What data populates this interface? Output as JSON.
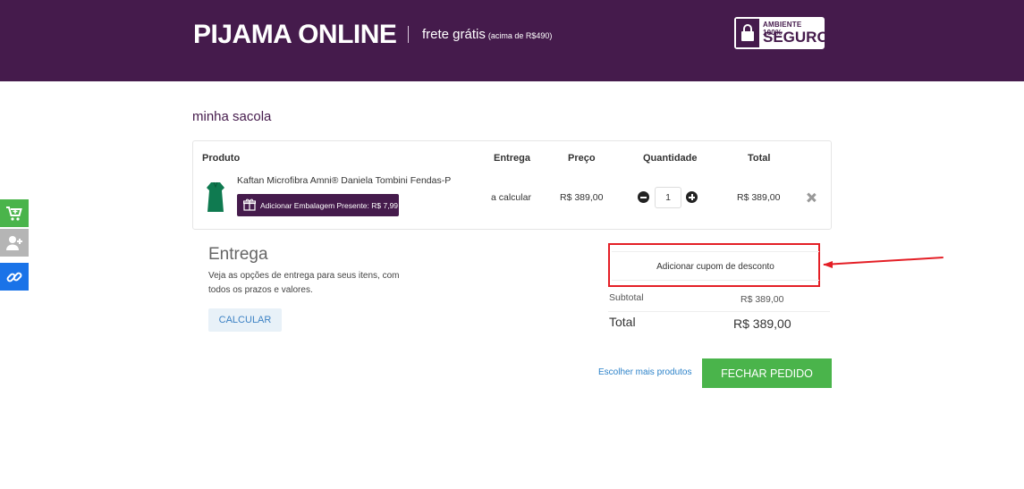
{
  "header": {
    "brand": "PIJAMA ONLINE",
    "shipping_text": "frete grátis",
    "shipping_note": "(acima de R$490)",
    "badge_line1": "AMBIENTE 100%",
    "badge_line2": "SEGURO"
  },
  "page": {
    "title": "minha sacola"
  },
  "cart": {
    "columns": {
      "product": "Produto",
      "delivery": "Entrega",
      "price": "Preço",
      "quantity": "Quantidade",
      "total": "Total"
    },
    "items": [
      {
        "name": "Kaftan Microfibra Amni® Daniela Tombini Fendas-P",
        "gift_label": "Adicionar Embalagem Presente: R$ 7,99",
        "delivery": "a calcular",
        "price": "R$ 389,00",
        "quantity": "1",
        "total": "R$ 389,00"
      }
    ]
  },
  "shipping": {
    "title": "Entrega",
    "description": "Veja as opções de entrega para seus itens, com todos os prazos e valores.",
    "calc_label": "CALCULAR"
  },
  "summary": {
    "coupon_label": "Adicionar cupom de desconto",
    "subtotal_label": "Subtotal",
    "subtotal_value": "R$ 389,00",
    "total_label": "Total",
    "total_value": "R$ 389,00"
  },
  "actions": {
    "more_products": "Escolher mais produtos",
    "checkout": "FECHAR PEDIDO"
  },
  "sidebar": [
    {
      "icon": "cart-add-icon",
      "color": "#4ab44b"
    },
    {
      "icon": "user-add-icon",
      "color": "#b5b5b5"
    },
    {
      "icon": "link-icon",
      "color": "#1a73e8"
    }
  ],
  "colors": {
    "brand": "#451b4c",
    "accent_green": "#4ab44b",
    "link_blue": "#2c82c9",
    "highlight_red": "#e41f26"
  }
}
